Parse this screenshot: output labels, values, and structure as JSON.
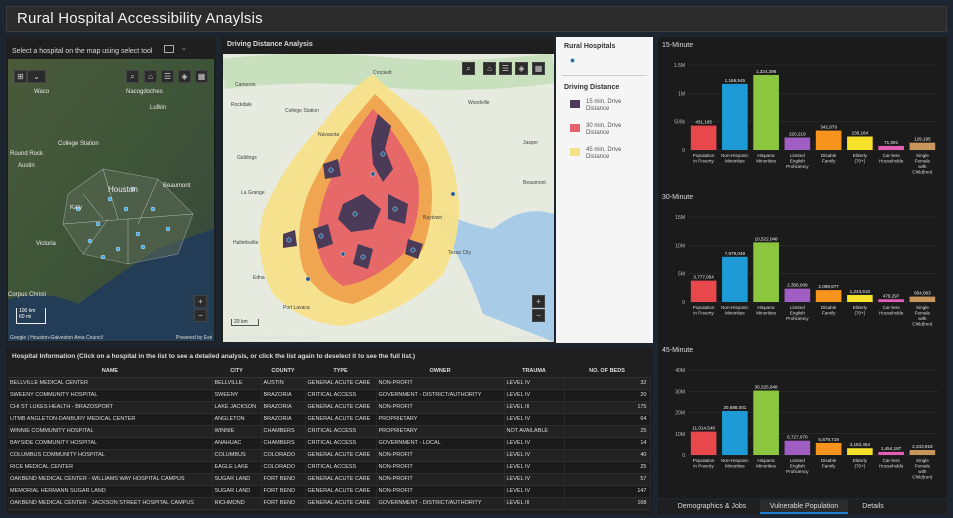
{
  "app": {
    "title": "Rural Hospital Accessibility Anaylsis"
  },
  "left_map": {
    "header": "Select a hospital on the map using select tool",
    "place_labels": [
      "Waco",
      "Nacogdoches",
      "Lufkin",
      "College Station",
      "Round Rock",
      "Austin",
      "Houston",
      "Beaumont",
      "Katy",
      "Victoria",
      "Corpus Christi"
    ],
    "scale_km": "100 km",
    "scale_mi": "60 mi",
    "attribution": "Google | Houston-Galveston Area Council",
    "powered_by": "Powered by Esri"
  },
  "center_map": {
    "header": "Driving Distance Analysis",
    "place_labels": [
      "Cameron",
      "Crockett",
      "Rockdale",
      "College Station",
      "Woodville",
      "Navasota",
      "Giddings",
      "Jasper",
      "La Grange",
      "Beaumont",
      "Hallettsville",
      "Baytown",
      "Texas City",
      "Edna",
      "Port Lavaca"
    ],
    "attribution": "Google | Houston-Galveston Area Council",
    "powered_by": "Powered by Esri",
    "scale_label": "20 km"
  },
  "legend": {
    "rural_title": "Rural Hospitals",
    "driving_title": "Driving Distance",
    "items": [
      {
        "label": "15 min. Drive Distance",
        "color": "#4b3a58"
      },
      {
        "label": "30 min. Drive Distance",
        "color": "#e4626a"
      },
      {
        "label": "45 min. Drive Distance",
        "color": "#f7e08a"
      }
    ]
  },
  "hospital_table": {
    "header": "Hospital Information (Click on a hospital in the list to see a detailed analysis, or click the list again to deselect it to see the full list.)",
    "columns": [
      "NAME",
      "CITY",
      "COUNTY",
      "TYPE",
      "OWNER",
      "TRAUMA",
      "NO. OF BEDS"
    ],
    "rows": [
      [
        "BELLVILLE MEDICAL CENTER",
        "BELLVILLE",
        "AUSTIN",
        "GENERAL ACUTE CARE",
        "NON-PROFIT",
        "LEVEL IV",
        "32"
      ],
      [
        "SWEENY COMMUNITY HOSPITAL",
        "SWEENY",
        "BRAZORIA",
        "CRITICAL ACCESS",
        "GOVERNMENT - DISTRICT/AUTHORITY",
        "LEVEL IV",
        "20"
      ],
      [
        "CHI ST LUKES HEALTH - BRAZOSPORT",
        "LAKE JACKSON",
        "BRAZORIA",
        "GENERAL ACUTE CARE",
        "NON-PROFIT",
        "LEVEL III",
        "175"
      ],
      [
        "UTMB ANGLETON-DANBURY MEDICAL CENTER",
        "ANGLETON",
        "BRAZORIA",
        "GENERAL ACUTE CARE",
        "PROPRIETARY",
        "LEVEL IV",
        "64"
      ],
      [
        "WINNIE COMMUNITY HOSPITAL",
        "WINNIE",
        "CHAMBERS",
        "CRITICAL ACCESS",
        "PROPRIETARY",
        "NOT AVAILABLE",
        "25"
      ],
      [
        "BAYSIDE COMMUNITY HOSPITAL",
        "ANAHUAC",
        "CHAMBERS",
        "CRITICAL ACCESS",
        "GOVERNMENT - LOCAL",
        "LEVEL IV",
        "14"
      ],
      [
        "COLUMBUS COMMUNITY HOSPITAL",
        "COLUMBUS",
        "COLORADO",
        "GENERAL ACUTE CARE",
        "NON-PROFIT",
        "LEVEL IV",
        "40"
      ],
      [
        "RICE MEDICAL CENTER",
        "EAGLE LAKE",
        "COLORADO",
        "CRITICAL ACCESS",
        "NON-PROFIT",
        "LEVEL IV",
        "25"
      ],
      [
        "OAKBEND MEDICAL CENTER - WILLIAMS WAY HOSPITAL CAMPUS",
        "SUGAR LAND",
        "FORT BEND",
        "GENERAL ACUTE CARE",
        "NON-PROFIT",
        "LEVEL IV",
        "57"
      ],
      [
        "MEMORIAL HERMANN SUGAR LAND",
        "SUGAR LAND",
        "FORT BEND",
        "GENERAL ACUTE CARE",
        "NON-PROFIT",
        "LEVEL IV",
        "147"
      ],
      [
        "OAKBEND MEDICAL CENTER - JACKSON STREET HOSPITAL CAMPUS",
        "RICHMOND",
        "FORT BEND",
        "GENERAL ACUTE CARE",
        "GOVERNMENT - DISTRICT/AUTHORITY",
        "LEVEL III",
        "168"
      ]
    ]
  },
  "chart_data": [
    {
      "type": "bar",
      "title": "15-Minute",
      "categories": [
        "Population in Poverty",
        "Non-Hispanic Minorities",
        "Hispanic Minorities",
        "Limited English Proficiency",
        "Disable Family",
        "Elderly (70+)",
        "Car-less Households",
        "Single Female with Child(ren)"
      ],
      "values": [
        431195,
        1166545,
        1324398,
        220219,
        342879,
        238164,
        71091,
        129195
      ],
      "labels": [
        "431,195",
        "1,166,545",
        "1,324,398",
        "220,219",
        "342,879",
        "238,164",
        "71,091",
        "129,195"
      ],
      "yticks": [
        "0",
        "500k",
        "1M",
        "1.5M"
      ],
      "ylim": [
        0,
        1500000
      ],
      "colors": [
        "#e8474b",
        "#1e9bd7",
        "#8cc63f",
        "#a05ec2",
        "#f7941d",
        "#f5e02a",
        "#e25fb5",
        "#c8955a"
      ]
    },
    {
      "type": "bar",
      "title": "30-Minute",
      "categories": [
        "Population in Poverty",
        "Non-Hispanic Minorities",
        "Hispanic Minorities",
        "Limited English Proficiency",
        "Disable Family",
        "Elderly (70+)",
        "Car-less Households",
        "Single Female with Child(ren)"
      ],
      "values": [
        3777054,
        7979049,
        10522048,
        2356009,
        2098977,
        1243610,
        479297,
        954083
      ],
      "labels": [
        "3,777,054",
        "7,979,049",
        "10,522,048",
        "2,356,009",
        "2,098,977",
        "1,243,610",
        "479,297",
        "954,083"
      ],
      "yticks": [
        "0",
        "5M",
        "10M",
        "15M"
      ],
      "ylim": [
        0,
        15000000
      ],
      "colors": [
        "#e8474b",
        "#1e9bd7",
        "#8cc63f",
        "#a05ec2",
        "#f7941d",
        "#f5e02a",
        "#e25fb5",
        "#c8955a"
      ]
    },
    {
      "type": "bar",
      "title": "45-Minute",
      "categories": [
        "Population in Poverty",
        "Non-Hispanic Minorities",
        "Hispanic Minorities",
        "Limited English Proficiency",
        "Disable Family",
        "Elderly (70+)",
        "Car-less Households",
        "Single Female with Child(ren)"
      ],
      "values": [
        11014548,
        20688001,
        30325848,
        6727070,
        5679719,
        3182454,
        1454187,
        2343918
      ],
      "labels": [
        "11,014,548",
        "20,688,001",
        "30,325,848",
        "6,727,070",
        "5,679,719",
        "3,182,454",
        "1,454,187",
        "2,343,918"
      ],
      "yticks": [
        "0",
        "10M",
        "20M",
        "30M",
        "40M"
      ],
      "ylim": [
        0,
        40000000
      ],
      "colors": [
        "#e8474b",
        "#1e9bd7",
        "#8cc63f",
        "#a05ec2",
        "#f7941d",
        "#f5e02a",
        "#e25fb5",
        "#c8955a"
      ]
    }
  ],
  "tabs": [
    {
      "label": "Demographics & Jobs",
      "active": false
    },
    {
      "label": "Vulnerable Population",
      "active": true
    },
    {
      "label": "Details",
      "active": false
    }
  ]
}
